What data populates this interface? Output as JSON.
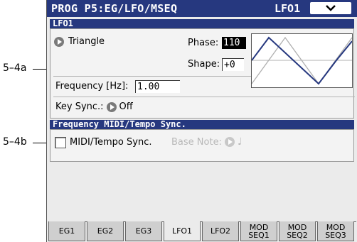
{
  "callouts": {
    "a": "5–4a",
    "b": "5–4b"
  },
  "header": {
    "title": "PROG P5:EG/LFO/MSEQ",
    "page": "LFO1"
  },
  "lfo_section": {
    "title": "LFO1",
    "waveform": "Triangle",
    "phase_label": "Phase:",
    "phase_value": "110",
    "shape_label": "Shape:",
    "shape_value": "+0",
    "frequency_label": "Frequency [Hz]:",
    "frequency_value": "1.00",
    "key_sync_label": "Key Sync.:",
    "key_sync_value": "Off"
  },
  "sync_section": {
    "title": "Frequency MIDI/Tempo Sync.",
    "checkbox_label": "MIDI/Tempo Sync.",
    "checked": false,
    "base_note_label": "Base Note:",
    "base_note_value": "♩"
  },
  "tabs": [
    {
      "label": "EG1",
      "active": false
    },
    {
      "label": "EG2",
      "active": false
    },
    {
      "label": "EG3",
      "active": false
    },
    {
      "label": "LFO1",
      "active": true
    },
    {
      "label": "LFO2",
      "active": false
    },
    {
      "label": "MOD SEQ1",
      "active": false
    },
    {
      "label": "MOD SEQ2",
      "active": false
    },
    {
      "label": "MOD SEQ3",
      "active": false
    }
  ],
  "colors": {
    "header_blue": "#26387f",
    "wave_blue": "#26387f",
    "wave_gray": "#b0b0b0"
  },
  "icons": {
    "menu": "chevron-down-icon",
    "select": "arrow-right-circle-icon"
  }
}
